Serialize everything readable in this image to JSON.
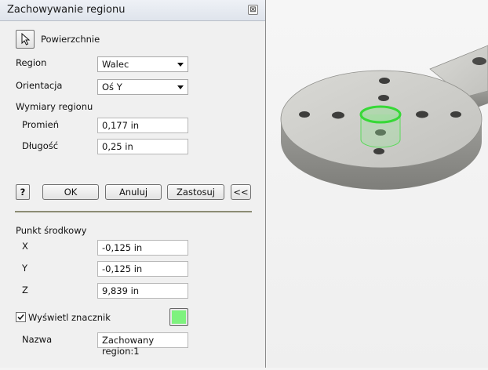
{
  "dialog": {
    "title": "Zachowywanie regionu",
    "close_glyph": "⊠",
    "surfaces_button_icon": "cursor-arrow-icon",
    "surfaces_label": "Powierzchnie",
    "region_label": "Region",
    "region_value": "Walec",
    "orientation_label": "Orientacja",
    "orientation_value": "Oś Y",
    "dimensions_label": "Wymiary regionu",
    "radius_label": "Promień",
    "radius_value": "0,177 in",
    "length_label": "Długość",
    "length_value": "0,25 in",
    "help_glyph": "?",
    "ok_label": "OK",
    "cancel_label": "Anuluj",
    "apply_label": "Zastosuj",
    "collapse_label": "<<",
    "center_point_label": "Punkt środkowy",
    "x_label": "X",
    "x_value": "-0,125 in",
    "y_label": "Y",
    "y_value": "-0,125 in",
    "z_label": "Z",
    "z_value": "9,839 in",
    "show_marker_label": "Wyświetl znacznik",
    "show_marker_checked": true,
    "marker_color": "#7ef27e",
    "name_label": "Nazwa",
    "name_value": "Zachowany region:1"
  },
  "viewport": {
    "part_color": "#c9c9c5",
    "highlight_color": "#4be04b"
  }
}
